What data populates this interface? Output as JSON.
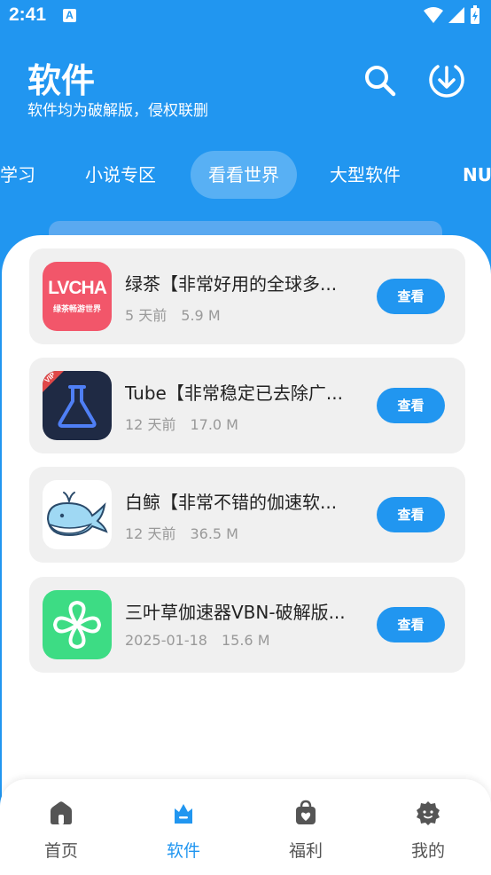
{
  "status": {
    "time": "2:41",
    "notif": "A"
  },
  "header": {
    "title": "软件",
    "subtitle": "软件均为破解版，侵权联删"
  },
  "tabs": [
    {
      "label": "学习"
    },
    {
      "label": "小说专区"
    },
    {
      "label": "看看世界",
      "active": true
    },
    {
      "label": "大型软件"
    },
    {
      "label": "NUI"
    }
  ],
  "apps": [
    {
      "name": "绿茶【非常好用的全球多...",
      "age": "5 天前",
      "size": "5.9 M",
      "button": "查看",
      "icon": "lvcha-app-icon",
      "icon_text": "LVCHA",
      "icon_subtext": "绿茶畅游世界"
    },
    {
      "name": "Tube【非常稳定已去除广...",
      "age": "12 天前",
      "size": "17.0 M",
      "button": "查看",
      "icon": "flask-app-icon",
      "badge": "VIP"
    },
    {
      "name": "白鲸【非常不错的伽速软...",
      "age": "12 天前",
      "size": "36.5 M",
      "button": "查看",
      "icon": "whale-app-icon"
    },
    {
      "name": "三叶草伽速器VBN-破解版...",
      "age": "2025-01-18",
      "size": "15.6 M",
      "button": "查看",
      "icon": "clover-app-icon"
    }
  ],
  "nav": [
    {
      "label": "首页",
      "icon": "home-icon"
    },
    {
      "label": "软件",
      "icon": "software-icon",
      "active": true
    },
    {
      "label": "福利",
      "icon": "gift-bag-icon"
    },
    {
      "label": "我的",
      "icon": "profile-icon"
    }
  ],
  "colors": {
    "primary": "#2196f0",
    "card_bg": "#f0f0f0",
    "lvcha_red": "#f2566a",
    "clover_green": "#3ddc84",
    "flask_dark": "#1f2a44"
  }
}
